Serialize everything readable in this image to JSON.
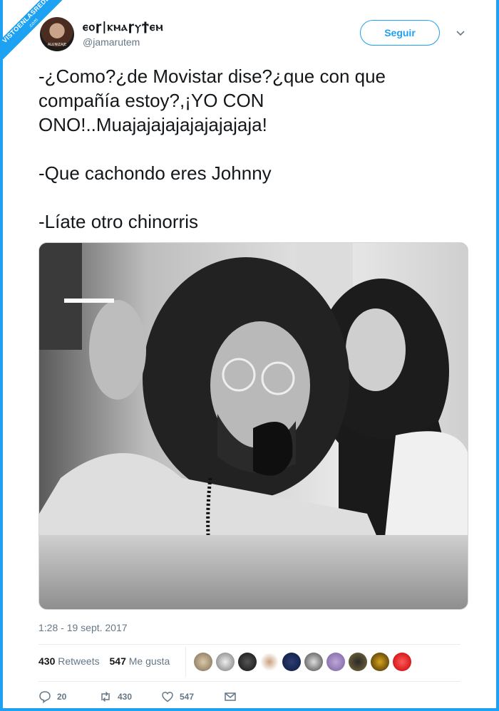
{
  "watermark": {
    "line1": "VISTOENLASREDES",
    "line2": ".com"
  },
  "user": {
    "display_name": "ⲉⲟɼ|ⲕⲙⲁɼⲩϯⲉⲙ",
    "handle": "@jamarutem",
    "avatar_caption": "ALUNIZAJE"
  },
  "header": {
    "follow_label": "Seguir"
  },
  "tweet": {
    "lines": [
      "-¿Como?¿de Movistar dise?¿que con que compañía estoy?,¡YO CON ONO!..Muajajajajajajajajaja!",
      "-Que cachondo eres Johnny",
      "-Líate otro chinorris"
    ],
    "timestamp": "1:28 - 19 sept. 2017"
  },
  "stats": {
    "retweets_count": "430",
    "retweets_label": "Retweets",
    "likes_count": "547",
    "likes_label": "Me gusta"
  },
  "actions": {
    "reply_count": "20",
    "retweet_count": "430",
    "like_count": "547"
  },
  "colors": {
    "accent": "#1da1f2",
    "muted": "#657786",
    "text": "#14171a"
  }
}
